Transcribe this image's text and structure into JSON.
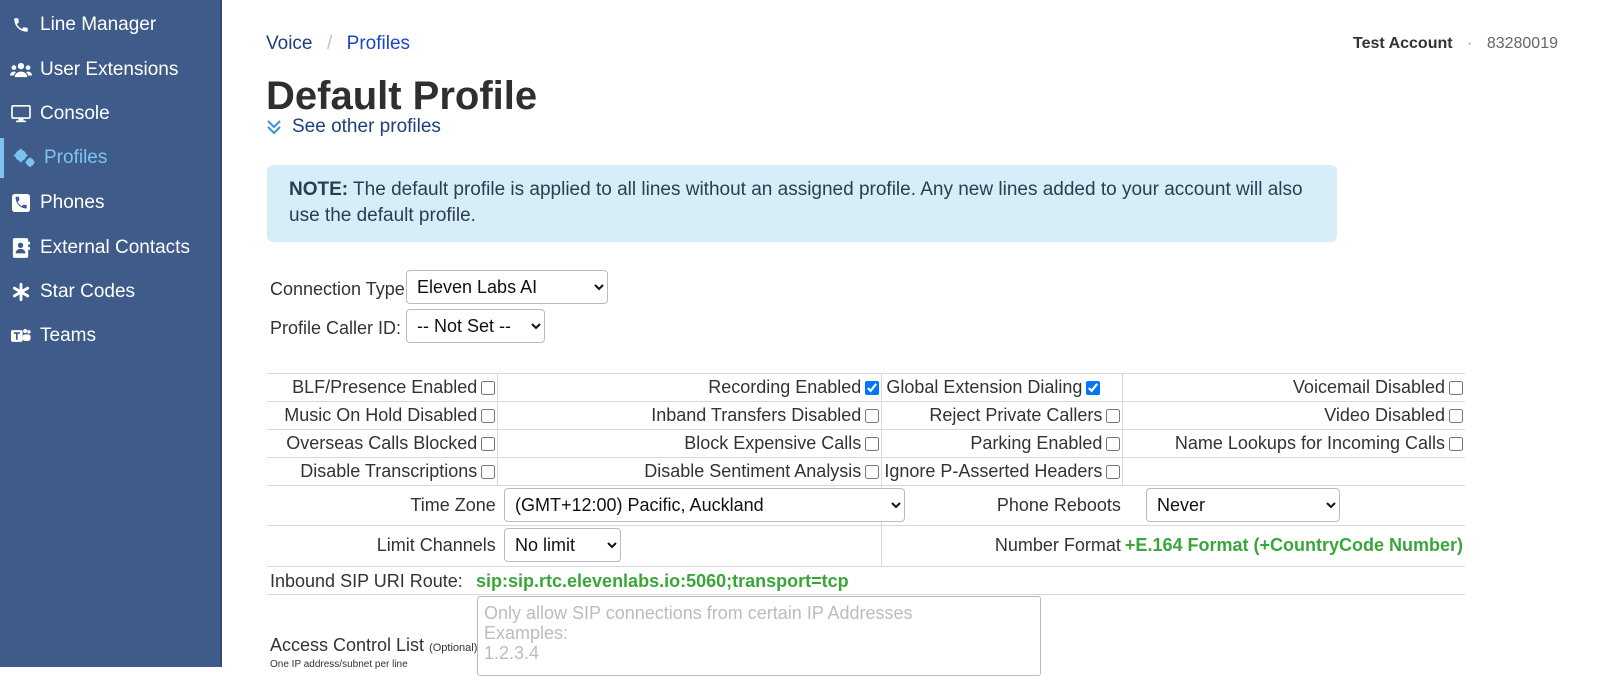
{
  "sidebar": {
    "items": [
      {
        "label": "Line Manager",
        "icon": "phone-icon"
      },
      {
        "label": "User Extensions",
        "icon": "users-icon"
      },
      {
        "label": "Console",
        "icon": "monitor-icon"
      },
      {
        "label": "Profiles",
        "icon": "cogs-icon",
        "active": true
      },
      {
        "label": "Phones",
        "icon": "phone-square-icon"
      },
      {
        "label": "External Contacts",
        "icon": "address-book-icon"
      },
      {
        "label": "Star Codes",
        "icon": "asterisk-icon"
      },
      {
        "label": "Teams",
        "icon": "teams-icon"
      }
    ]
  },
  "breadcrumb": {
    "root": "Voice",
    "separator": "/",
    "current": "Profiles"
  },
  "account": {
    "name": "Test Account",
    "separator": "·",
    "id": "83280019"
  },
  "page": {
    "title": "Default Profile",
    "see_other": "See other profiles"
  },
  "note": {
    "prefix": "NOTE:",
    "text": " The default profile is applied to all lines without an assigned profile. Any new lines added to your account will also use the default profile."
  },
  "connection": {
    "label": "Connection Type:",
    "value": "Eleven Labs AI"
  },
  "caller_id": {
    "label": "Profile Caller ID:",
    "value": "-- Not Set --"
  },
  "options": {
    "blf": {
      "label": "BLF/Presence Enabled",
      "checked": false
    },
    "recording": {
      "label": "Recording Enabled",
      "checked": true
    },
    "global_ext": {
      "label": "Global Extension Dialing",
      "checked": true
    },
    "voicemail": {
      "label": "Voicemail Disabled",
      "checked": false
    },
    "moh": {
      "label": "Music On Hold Disabled",
      "checked": false
    },
    "inband": {
      "label": "Inband Transfers Disabled",
      "checked": false
    },
    "reject_private": {
      "label": "Reject Private Callers",
      "checked": false
    },
    "video": {
      "label": "Video Disabled",
      "checked": false
    },
    "overseas": {
      "label": "Overseas Calls Blocked",
      "checked": false
    },
    "expensive": {
      "label": "Block Expensive Calls",
      "checked": false
    },
    "parking": {
      "label": "Parking Enabled",
      "checked": false
    },
    "name_lookup": {
      "label": "Name Lookups for Incoming Calls",
      "checked": false
    },
    "transcriptions": {
      "label": "Disable Transcriptions",
      "checked": false
    },
    "sentiment": {
      "label": "Disable Sentiment Analysis",
      "checked": false
    },
    "ignore_pai": {
      "label": "Ignore P-Asserted Headers",
      "checked": false
    }
  },
  "time_zone": {
    "label": "Time Zone",
    "value": "(GMT+12:00) Pacific, Auckland"
  },
  "phone_reboots": {
    "label": "Phone Reboots",
    "value": "Never"
  },
  "limit_channels": {
    "label": "Limit Channels",
    "value": "No limit"
  },
  "number_format": {
    "label": "Number Format",
    "value": "+E.164 Format (+CountryCode Number)"
  },
  "sip_route": {
    "label": "Inbound SIP URI Route:",
    "value": "sip:sip.rtc.elevenlabs.io:5060;transport=tcp"
  },
  "acl": {
    "label": "Access Control List",
    "optional": "(Optional)",
    "hint": "One IP address/subnet per line",
    "placeholder": "Only allow SIP connections from certain IP Addresses\nExamples:\n1.2.3.4"
  }
}
